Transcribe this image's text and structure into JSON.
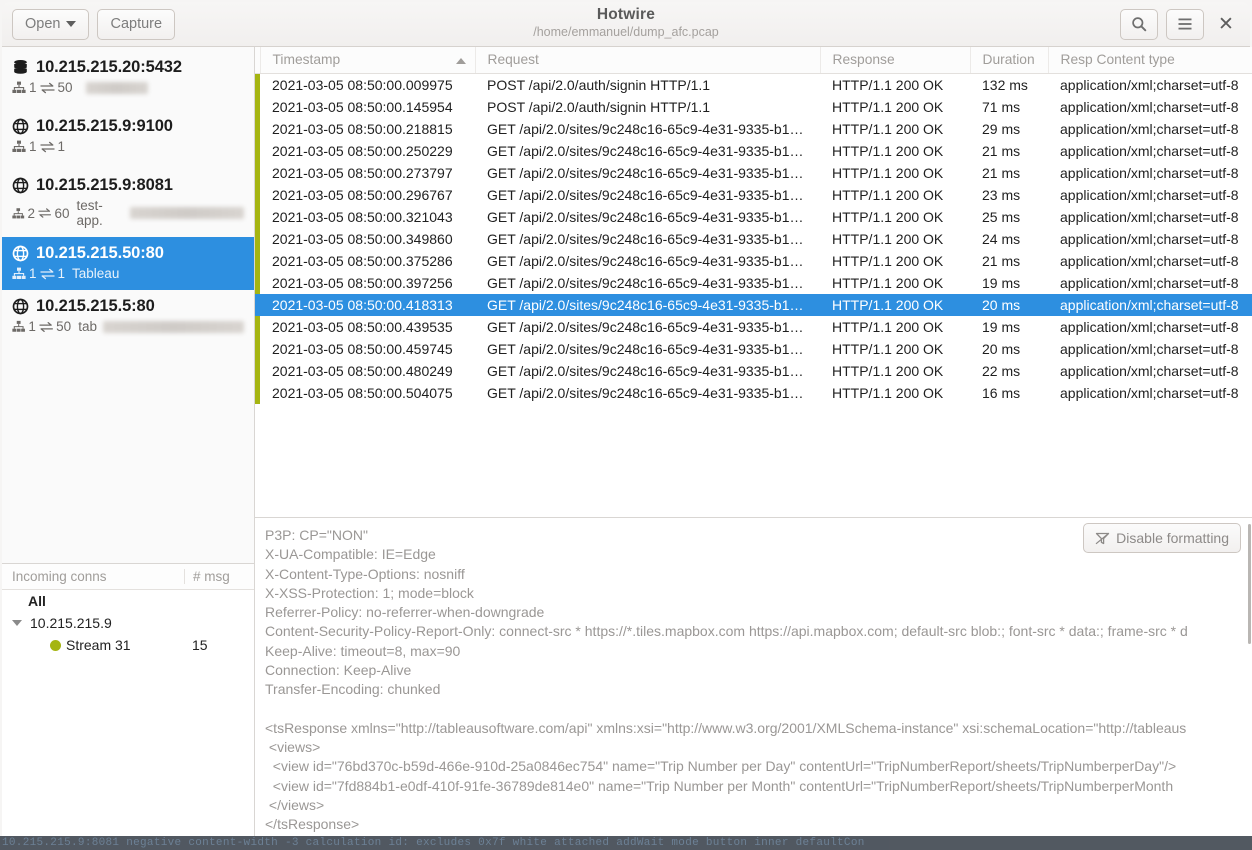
{
  "window": {
    "title": "Hotwire",
    "subtitle": "/home/emmanuel/dump_afc.pcap",
    "open_label": "Open",
    "capture_label": "Capture",
    "search_icon": "search-icon",
    "menu_icon": "hamburger-icon",
    "close_icon": "close-icon"
  },
  "sidebar": {
    "connections": [
      {
        "icon": "database-icon",
        "host": "10.215.215.20:5432",
        "conns": "1",
        "msgs": "50",
        "label": "",
        "label_blurred": true,
        "blur_width": 62,
        "selected": false
      },
      {
        "icon": "globe-icon",
        "host": "10.215.215.9:9100",
        "conns": "1",
        "msgs": "1",
        "label": "",
        "label_blurred": false,
        "blur_width": 0,
        "selected": false
      },
      {
        "icon": "globe-icon",
        "host": "10.215.215.9:8081",
        "conns": "2",
        "msgs": "60",
        "label": "test-app.",
        "label_blurred": true,
        "blur_width": 128,
        "selected": false
      },
      {
        "icon": "globe-icon",
        "host": "10.215.215.50:80",
        "conns": "1",
        "msgs": "1",
        "label": "Tableau",
        "label_blurred": false,
        "blur_width": 0,
        "selected": true
      },
      {
        "icon": "globe-icon",
        "host": "10.215.215.5:80",
        "conns": "1",
        "msgs": "50",
        "label": "tab",
        "label_blurred": true,
        "blur_width": 148,
        "selected": false
      }
    ],
    "incoming": {
      "header_conns": "Incoming conns",
      "header_msgs": "# msg",
      "rows": [
        {
          "level": 0,
          "label": "All",
          "count": "",
          "expander": false,
          "dot": false
        },
        {
          "level": 1,
          "label": "10.215.215.9",
          "count": "",
          "expander": true,
          "dot": false
        },
        {
          "level": 2,
          "label": "Stream 31",
          "count": "15",
          "expander": false,
          "dot": true
        }
      ]
    }
  },
  "table": {
    "columns": [
      {
        "key": "timestamp",
        "label": "Timestamp",
        "sorted": "asc"
      },
      {
        "key": "request",
        "label": "Request",
        "sorted": ""
      },
      {
        "key": "response",
        "label": "Response",
        "sorted": ""
      },
      {
        "key": "duration",
        "label": "Duration",
        "sorted": ""
      },
      {
        "key": "content_type",
        "label": "Resp Content type",
        "sorted": ""
      }
    ],
    "rows": [
      {
        "timestamp": "2021-03-05 08:50:00.009975",
        "request": "POST /api/2.0/auth/signin HTTP/1.1",
        "response": "HTTP/1.1 200 OK",
        "duration": "132 ms",
        "content_type": "application/xml;charset=utf-8",
        "selected": false
      },
      {
        "timestamp": "2021-03-05 08:50:00.145954",
        "request": "POST /api/2.0/auth/signin HTTP/1.1",
        "response": "HTTP/1.1 200 OK",
        "duration": "71 ms",
        "content_type": "application/xml;charset=utf-8",
        "selected": false
      },
      {
        "timestamp": "2021-03-05 08:50:00.218815",
        "request": "GET /api/2.0/sites/9c248c16-65c9-4e31-9335-b1…",
        "response": "HTTP/1.1 200 OK",
        "duration": "29 ms",
        "content_type": "application/xml;charset=utf-8",
        "selected": false
      },
      {
        "timestamp": "2021-03-05 08:50:00.250229",
        "request": "GET /api/2.0/sites/9c248c16-65c9-4e31-9335-b1…",
        "response": "HTTP/1.1 200 OK",
        "duration": "21 ms",
        "content_type": "application/xml;charset=utf-8",
        "selected": false
      },
      {
        "timestamp": "2021-03-05 08:50:00.273797",
        "request": "GET /api/2.0/sites/9c248c16-65c9-4e31-9335-b1…",
        "response": "HTTP/1.1 200 OK",
        "duration": "21 ms",
        "content_type": "application/xml;charset=utf-8",
        "selected": false
      },
      {
        "timestamp": "2021-03-05 08:50:00.296767",
        "request": "GET /api/2.0/sites/9c248c16-65c9-4e31-9335-b1…",
        "response": "HTTP/1.1 200 OK",
        "duration": "23 ms",
        "content_type": "application/xml;charset=utf-8",
        "selected": false
      },
      {
        "timestamp": "2021-03-05 08:50:00.321043",
        "request": "GET /api/2.0/sites/9c248c16-65c9-4e31-9335-b1…",
        "response": "HTTP/1.1 200 OK",
        "duration": "25 ms",
        "content_type": "application/xml;charset=utf-8",
        "selected": false
      },
      {
        "timestamp": "2021-03-05 08:50:00.349860",
        "request": "GET /api/2.0/sites/9c248c16-65c9-4e31-9335-b1…",
        "response": "HTTP/1.1 200 OK",
        "duration": "24 ms",
        "content_type": "application/xml;charset=utf-8",
        "selected": false
      },
      {
        "timestamp": "2021-03-05 08:50:00.375286",
        "request": "GET /api/2.0/sites/9c248c16-65c9-4e31-9335-b1…",
        "response": "HTTP/1.1 200 OK",
        "duration": "21 ms",
        "content_type": "application/xml;charset=utf-8",
        "selected": false
      },
      {
        "timestamp": "2021-03-05 08:50:00.397256",
        "request": "GET /api/2.0/sites/9c248c16-65c9-4e31-9335-b1…",
        "response": "HTTP/1.1 200 OK",
        "duration": "19 ms",
        "content_type": "application/xml;charset=utf-8",
        "selected": false
      },
      {
        "timestamp": "2021-03-05 08:50:00.418313",
        "request": "GET /api/2.0/sites/9c248c16-65c9-4e31-9335-b1…",
        "response": "HTTP/1.1 200 OK",
        "duration": "20 ms",
        "content_type": "application/xml;charset=utf-8",
        "selected": true
      },
      {
        "timestamp": "2021-03-05 08:50:00.439535",
        "request": "GET /api/2.0/sites/9c248c16-65c9-4e31-9335-b1…",
        "response": "HTTP/1.1 200 OK",
        "duration": "19 ms",
        "content_type": "application/xml;charset=utf-8",
        "selected": false
      },
      {
        "timestamp": "2021-03-05 08:50:00.459745",
        "request": "GET /api/2.0/sites/9c248c16-65c9-4e31-9335-b1…",
        "response": "HTTP/1.1 200 OK",
        "duration": "20 ms",
        "content_type": "application/xml;charset=utf-8",
        "selected": false
      },
      {
        "timestamp": "2021-03-05 08:50:00.480249",
        "request": "GET /api/2.0/sites/9c248c16-65c9-4e31-9335-b1…",
        "response": "HTTP/1.1 200 OK",
        "duration": "22 ms",
        "content_type": "application/xml;charset=utf-8",
        "selected": false
      },
      {
        "timestamp": "2021-03-05 08:50:00.504075",
        "request": "GET /api/2.0/sites/9c248c16-65c9-4e31-9335-b1…",
        "response": "HTTP/1.1 200 OK",
        "duration": "16 ms",
        "content_type": "application/xml;charset=utf-8",
        "selected": false
      }
    ]
  },
  "detail": {
    "disable_formatting_label": "Disable formatting",
    "disable_formatting_icon": "format-off-icon",
    "headers": "P3P: CP=\"NON\"\nX-UA-Compatible: IE=Edge\nX-Content-Type-Options: nosniff\nX-XSS-Protection: 1; mode=block\nReferrer-Policy: no-referrer-when-downgrade\nContent-Security-Policy-Report-Only: connect-src * https://*.tiles.mapbox.com https://api.mapbox.com; default-src blob:; font-src * data:; frame-src * d\nKeep-Alive: timeout=8, max=90\nConnection: Keep-Alive\nTransfer-Encoding: chunked",
    "xml_lines": [
      "<tsResponse xmlns=\"http://tableausoftware.com/api\" xmlns:xsi=\"http://www.w3.org/2001/XMLSchema-instance\" xsi:schemaLocation=\"http://tableaus",
      " <views>",
      "  <view id=\"76bd370c-b59d-466e-910d-25a0846ec754\" name=\"Trip Number per Day\" contentUrl=\"TripNumberReport/sheets/TripNumberperDay\"/>",
      "  <view id=\"7fd884b1-e0df-410f-91fe-36789de814e0\" name=\"Trip Number per Month\" contentUrl=\"TripNumberReport/sheets/TripNumberperMonth",
      " </views>",
      "</tsResponse>"
    ]
  },
  "desktop_strip": "10.215.215.9:8081  negative content-width  -3  calculation id: excludes 0x7f white attached addWait  mode  button  inner  defaultCon",
  "colors": {
    "accent_blue": "#2d8fe0",
    "flow_olive": "#a5b512",
    "chrome_bg": "#f6f5f4"
  }
}
